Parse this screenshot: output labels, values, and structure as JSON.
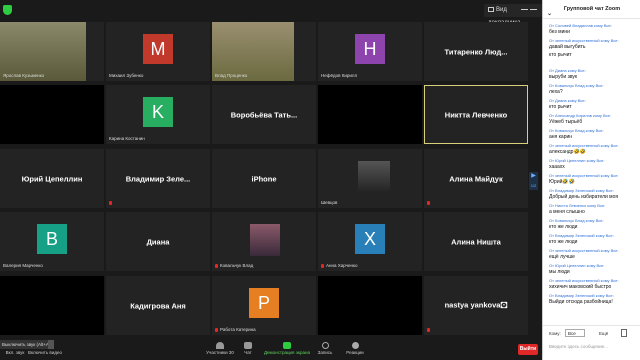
{
  "topbar": {
    "view_label": "Вид докладчика"
  },
  "tiles": [
    {
      "id": "t1",
      "name": "",
      "label": "Ярослав Кузьменко",
      "type": "photo",
      "muted": false
    },
    {
      "id": "t2",
      "name": "",
      "label": "Михаил Зубенко",
      "type": "avatar",
      "letter": "M",
      "color": "#c0392b",
      "muted": false
    },
    {
      "id": "t3",
      "name": "",
      "label": "Влад Проценко",
      "type": "photo",
      "muted": false
    },
    {
      "id": "t4",
      "name": "",
      "label": "Нефёдов Кирилл",
      "type": "avatar",
      "letter": "H",
      "color": "#8e44ad",
      "muted": false
    },
    {
      "id": "t5",
      "name": "Титаренко Люд...",
      "label": "",
      "type": "name",
      "muted": false
    },
    {
      "id": "t6",
      "name": "",
      "label": "",
      "type": "black",
      "muted": false
    },
    {
      "id": "t7",
      "name": "",
      "label": "Карина Костанин",
      "type": "avatar",
      "letter": "K",
      "color": "#27ae60",
      "muted": false
    },
    {
      "id": "t8",
      "name": "Воробьёва Тать...",
      "label": "",
      "type": "name",
      "muted": false
    },
    {
      "id": "t9",
      "name": "",
      "label": "",
      "type": "black",
      "muted": false
    },
    {
      "id": "t10",
      "name": "Никтта Левченко",
      "label": "",
      "type": "name",
      "muted": false,
      "active": true
    },
    {
      "id": "t11",
      "name": "Юрий Цепеллин",
      "label": "",
      "type": "name",
      "muted": false
    },
    {
      "id": "t12",
      "name": "Владимир Зеле...",
      "label": "",
      "type": "name",
      "muted": true
    },
    {
      "id": "t13",
      "name": "iPhone",
      "label": "",
      "type": "name",
      "muted": false
    },
    {
      "id": "t14",
      "name": "",
      "label": "Шевцов",
      "type": "photo",
      "muted": false
    },
    {
      "id": "t15",
      "name": "Алина Майдук",
      "label": "",
      "type": "name",
      "muted": true
    },
    {
      "id": "t16",
      "name": "",
      "label": "Валерия Марченко",
      "type": "avatar",
      "letter": "B",
      "color": "#16a085",
      "muted": false
    },
    {
      "id": "t17",
      "name": "Диана",
      "label": "",
      "type": "name",
      "muted": false
    },
    {
      "id": "t18",
      "name": "",
      "label": "Ковальчук Влад",
      "type": "photo",
      "muted": true
    },
    {
      "id": "t19",
      "name": "",
      "label": "Анна Харченко",
      "type": "avatar",
      "letter": "X",
      "color": "#2980b9",
      "muted": true
    },
    {
      "id": "t20",
      "name": "Алина Ништа",
      "label": "",
      "type": "name",
      "muted": false
    },
    {
      "id": "t21",
      "name": "",
      "label": "",
      "type": "black",
      "muted": false
    },
    {
      "id": "t22",
      "name": "Кадигрова Аня",
      "label": "",
      "type": "name",
      "muted": false
    },
    {
      "id": "t23",
      "name": "",
      "label": "Работа Катерина",
      "type": "avatar",
      "letter": "P",
      "color": "#e67e22",
      "muted": true
    },
    {
      "id": "t24",
      "name": "",
      "label": "",
      "type": "black",
      "muted": false
    },
    {
      "id": "t25",
      "name": "nastya yankova🖸",
      "label": "",
      "type": "name",
      "muted": true
    }
  ],
  "toolbar": {
    "toast": "Выключить звук (Alt+A)",
    "mute_label": "Вкл. звук",
    "video_label": "Включить видео",
    "participants_label": "Участники",
    "participants_count": "30",
    "chat_label": "Чат",
    "share_label": "Демонстрация экрана",
    "record_label": "Запись",
    "reactions_label": "Реакции",
    "end_label": "Выйти"
  },
  "chat": {
    "title": "Групповой чат Zoom",
    "messages": [
      {
        "h": "От Соловей Владислав кому Все:",
        "t": "без мини"
      },
      {
        "h": "От зеленый искусственный кому Все:",
        "t": "давай выгубить"
      },
      {
        "h": "",
        "t": "кто рычит"
      },
      {
        "h": "От Диана кому Все:",
        "t": "выруби звук"
      },
      {
        "h": "От Ковальчук Влад кому Все:",
        "t": "леха?"
      },
      {
        "h": "От Диана кому Все:",
        "t": "кто рычит"
      },
      {
        "h": "От Александр Кирилов кому Все:",
        "t": "Уёжеб тырьёб"
      },
      {
        "h": "От Ковальчук Влад кому Все:",
        "t": "аня карин"
      },
      {
        "h": "От зеленый искусственный кому Все:",
        "t": "александр🤣🤣"
      },
      {
        "h": "От Юрий Цепеллин кому Все:",
        "t": "хааахх"
      },
      {
        "h": "От зеленый искусственный кому Все:",
        "t": "Юрий🤣🤣"
      },
      {
        "h": "От Владимир Зеленский кому Все:",
        "t": "Добрый день избиратели моя"
      },
      {
        "h": "От Никтта Левченко кому Все:",
        "t": "а меня слышно"
      },
      {
        "h": "От Ковальчук Влад кому Все:",
        "t": "кто же люди"
      },
      {
        "h": "От Владимир Зеленский кому Все:",
        "t": "кто же люди"
      },
      {
        "h": "От зеленый искусственный кому Все:",
        "t": "ещё лучше"
      },
      {
        "h": "От Юрий Цепеллин кому Все:",
        "t": "мы люди"
      },
      {
        "h": "От зеленый искусственный кому Все:",
        "t": "хихичич маковский быстро"
      },
      {
        "h": "От Владимир Зеленский кому Все:",
        "t": "Выйди отсюда разбойница!"
      }
    ],
    "to_label": "Кому:",
    "to_value": "Все",
    "more_label": "Ещё",
    "input_placeholder": "Введите здесь сообщение..."
  }
}
